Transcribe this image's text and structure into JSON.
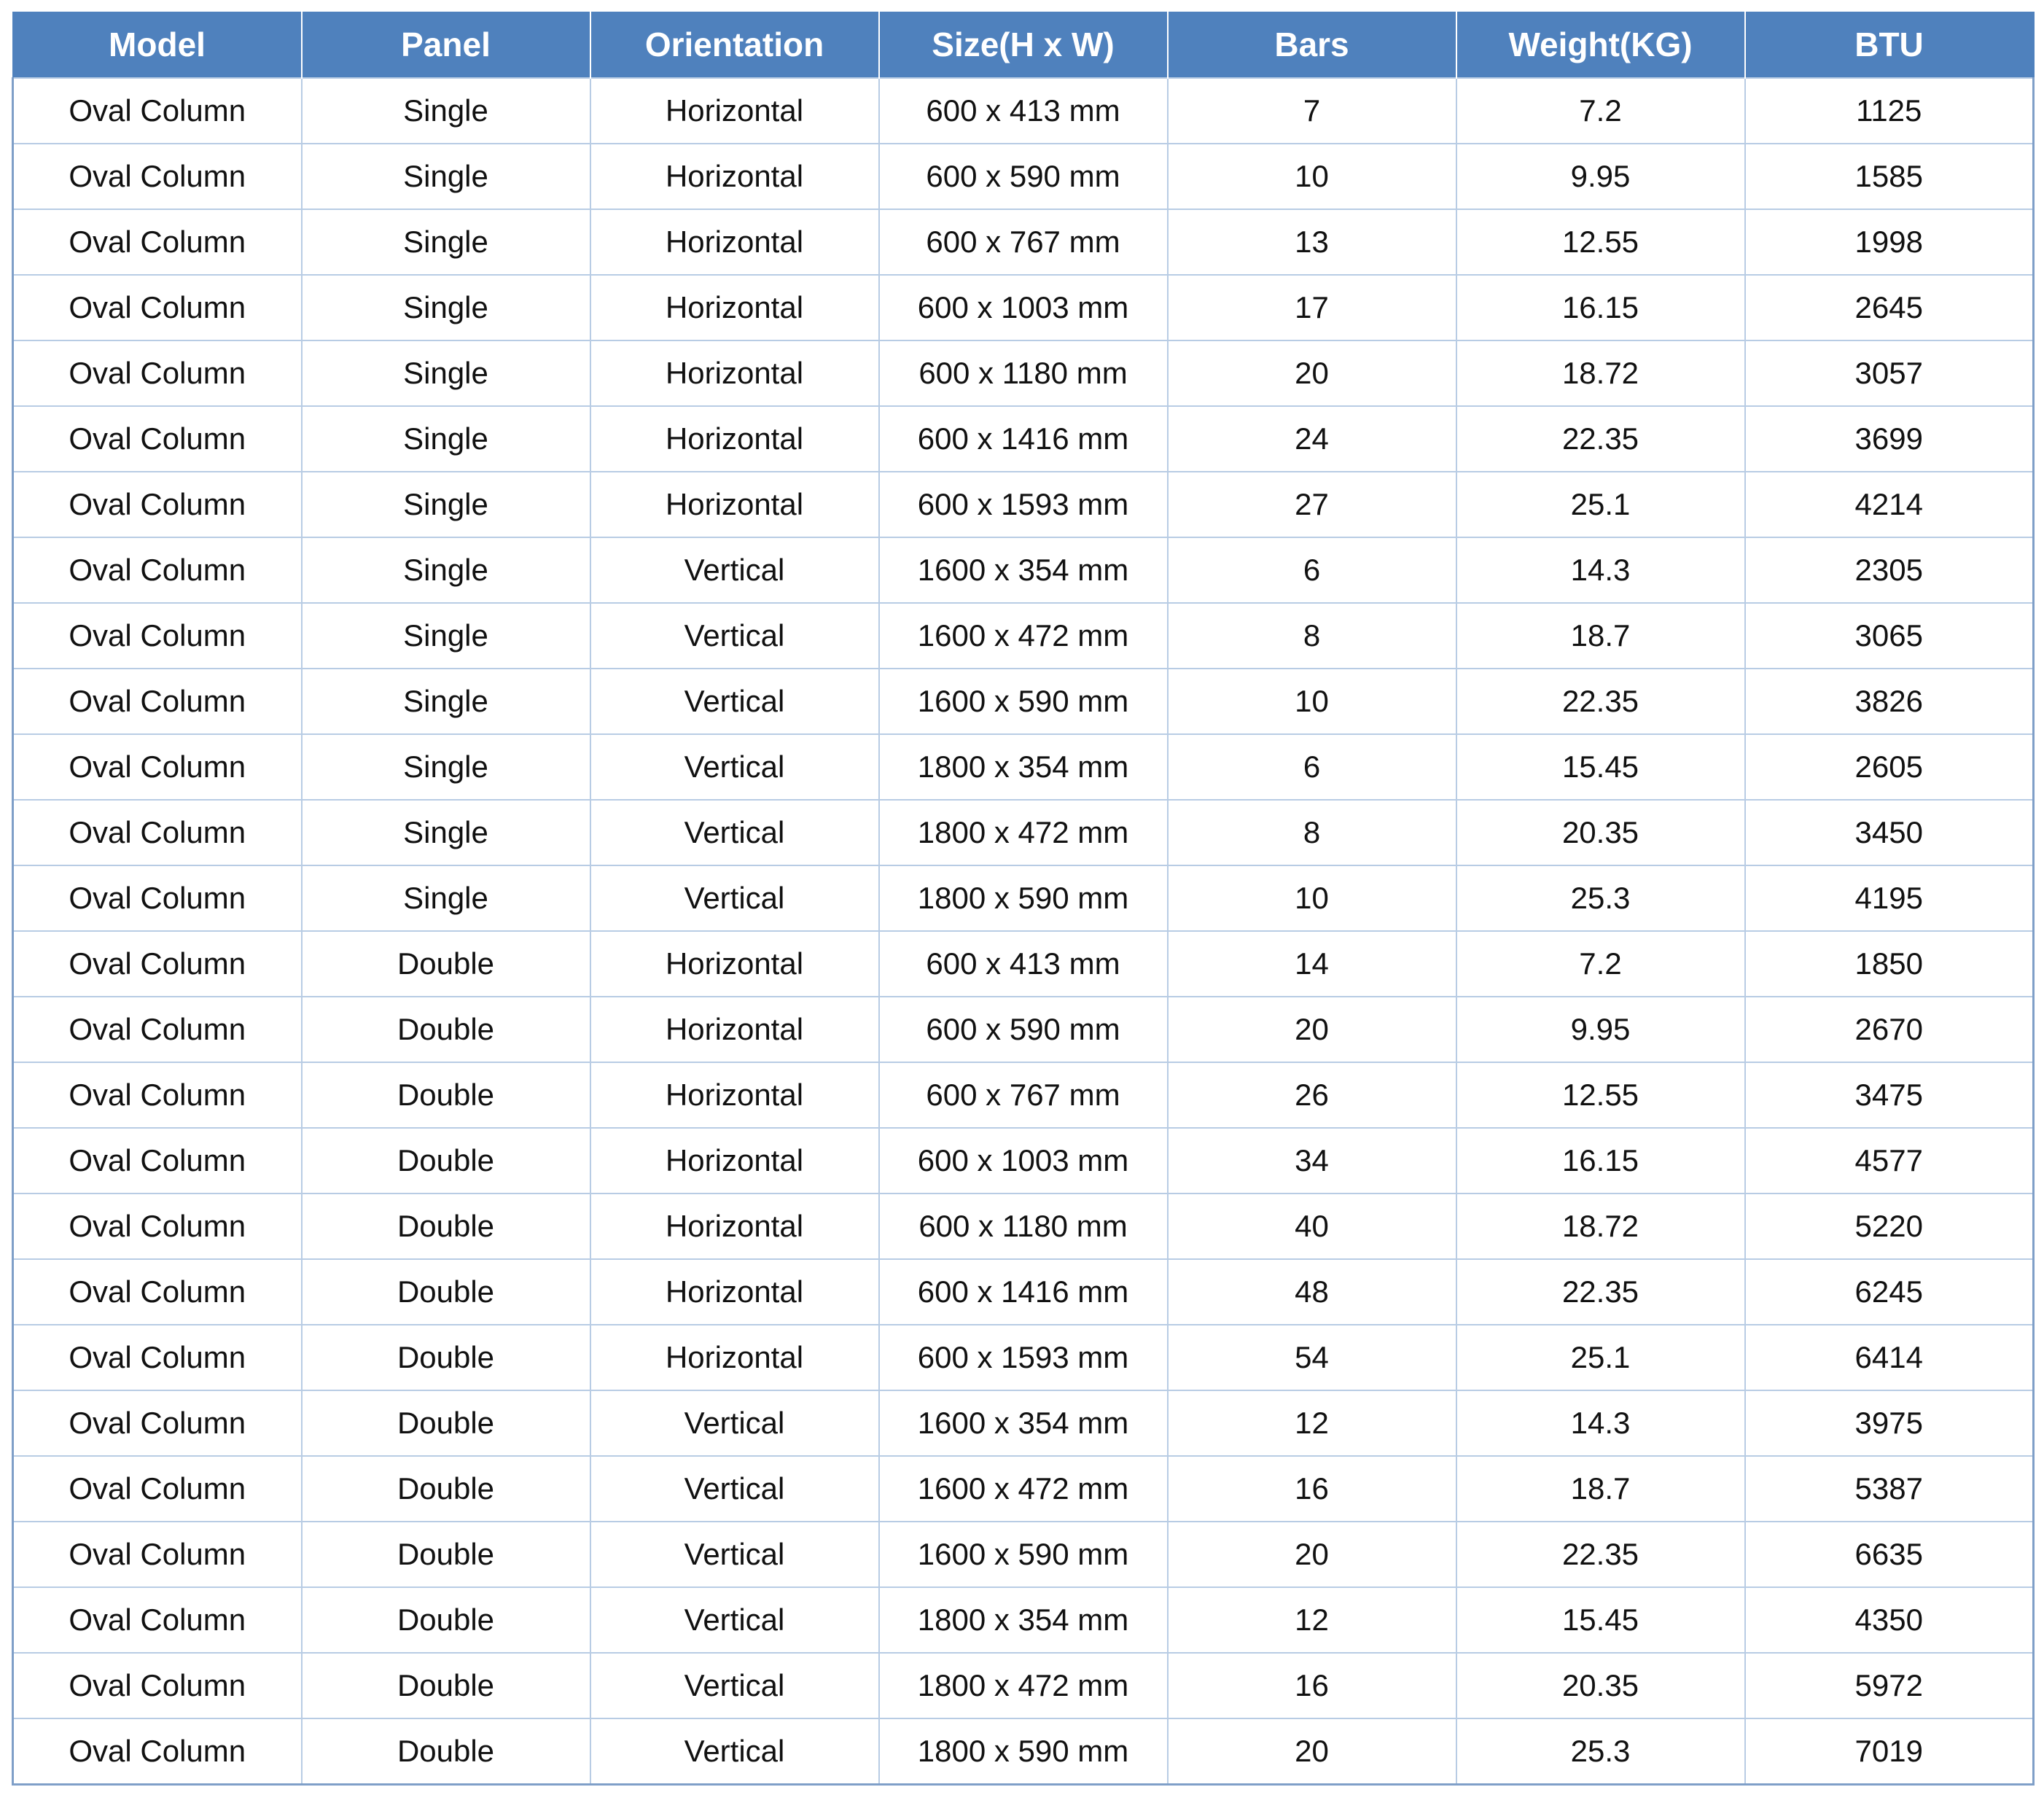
{
  "table": {
    "columns": [
      "Model",
      "Panel",
      "Orientation",
      "Size(H x W)",
      "Bars",
      "Weight(KG)",
      "BTU"
    ],
    "rows": [
      [
        "Oval Column",
        "Single",
        "Horizontal",
        "600 x 413 mm",
        "7",
        "7.2",
        "1125"
      ],
      [
        "Oval Column",
        "Single",
        "Horizontal",
        "600 x 590 mm",
        "10",
        "9.95",
        "1585"
      ],
      [
        "Oval Column",
        "Single",
        "Horizontal",
        "600 x 767 mm",
        "13",
        "12.55",
        "1998"
      ],
      [
        "Oval Column",
        "Single",
        "Horizontal",
        "600 x 1003 mm",
        "17",
        "16.15",
        "2645"
      ],
      [
        "Oval Column",
        "Single",
        "Horizontal",
        "600 x 1180 mm",
        "20",
        "18.72",
        "3057"
      ],
      [
        "Oval Column",
        "Single",
        "Horizontal",
        "600 x 1416 mm",
        "24",
        "22.35",
        "3699"
      ],
      [
        "Oval Column",
        "Single",
        "Horizontal",
        "600 x 1593 mm",
        "27",
        "25.1",
        "4214"
      ],
      [
        "Oval Column",
        "Single",
        "Vertical",
        "1600 x 354 mm",
        "6",
        "14.3",
        "2305"
      ],
      [
        "Oval Column",
        "Single",
        "Vertical",
        "1600 x 472 mm",
        "8",
        "18.7",
        "3065"
      ],
      [
        "Oval Column",
        "Single",
        "Vertical",
        "1600 x 590 mm",
        "10",
        "22.35",
        "3826"
      ],
      [
        "Oval Column",
        "Single",
        "Vertical",
        "1800 x 354 mm",
        "6",
        "15.45",
        "2605"
      ],
      [
        "Oval Column",
        "Single",
        "Vertical",
        "1800 x 472 mm",
        "8",
        "20.35",
        "3450"
      ],
      [
        "Oval Column",
        "Single",
        "Vertical",
        "1800 x 590 mm",
        "10",
        "25.3",
        "4195"
      ],
      [
        "Oval Column",
        "Double",
        "Horizontal",
        "600 x 413 mm",
        "14",
        "7.2",
        "1850"
      ],
      [
        "Oval Column",
        "Double",
        "Horizontal",
        "600 x 590 mm",
        "20",
        "9.95",
        "2670"
      ],
      [
        "Oval Column",
        "Double",
        "Horizontal",
        "600 x 767 mm",
        "26",
        "12.55",
        "3475"
      ],
      [
        "Oval Column",
        "Double",
        "Horizontal",
        "600 x 1003 mm",
        "34",
        "16.15",
        "4577"
      ],
      [
        "Oval Column",
        "Double",
        "Horizontal",
        "600 x 1180 mm",
        "40",
        "18.72",
        "5220"
      ],
      [
        "Oval Column",
        "Double",
        "Horizontal",
        "600 x 1416 mm",
        "48",
        "22.35",
        "6245"
      ],
      [
        "Oval Column",
        "Double",
        "Horizontal",
        "600 x 1593 mm",
        "54",
        "25.1",
        "6414"
      ],
      [
        "Oval Column",
        "Double",
        "Vertical",
        "1600 x 354 mm",
        "12",
        "14.3",
        "3975"
      ],
      [
        "Oval Column",
        "Double",
        "Vertical",
        "1600 x 472 mm",
        "16",
        "18.7",
        "5387"
      ],
      [
        "Oval Column",
        "Double",
        "Vertical",
        "1600 x 590 mm",
        "20",
        "22.35",
        "6635"
      ],
      [
        "Oval Column",
        "Double",
        "Vertical",
        "1800 x 354 mm",
        "12",
        "15.45",
        "4350"
      ],
      [
        "Oval Column",
        "Double",
        "Vertical",
        "1800 x 472 mm",
        "16",
        "20.35",
        "5972"
      ],
      [
        "Oval Column",
        "Double",
        "Vertical",
        "1800 x 590 mm",
        "20",
        "25.3",
        "7019"
      ]
    ]
  },
  "colors": {
    "header_background": "#4f81bd",
    "header_text": "#ffffff",
    "grid_lines": "#b8cce4"
  }
}
